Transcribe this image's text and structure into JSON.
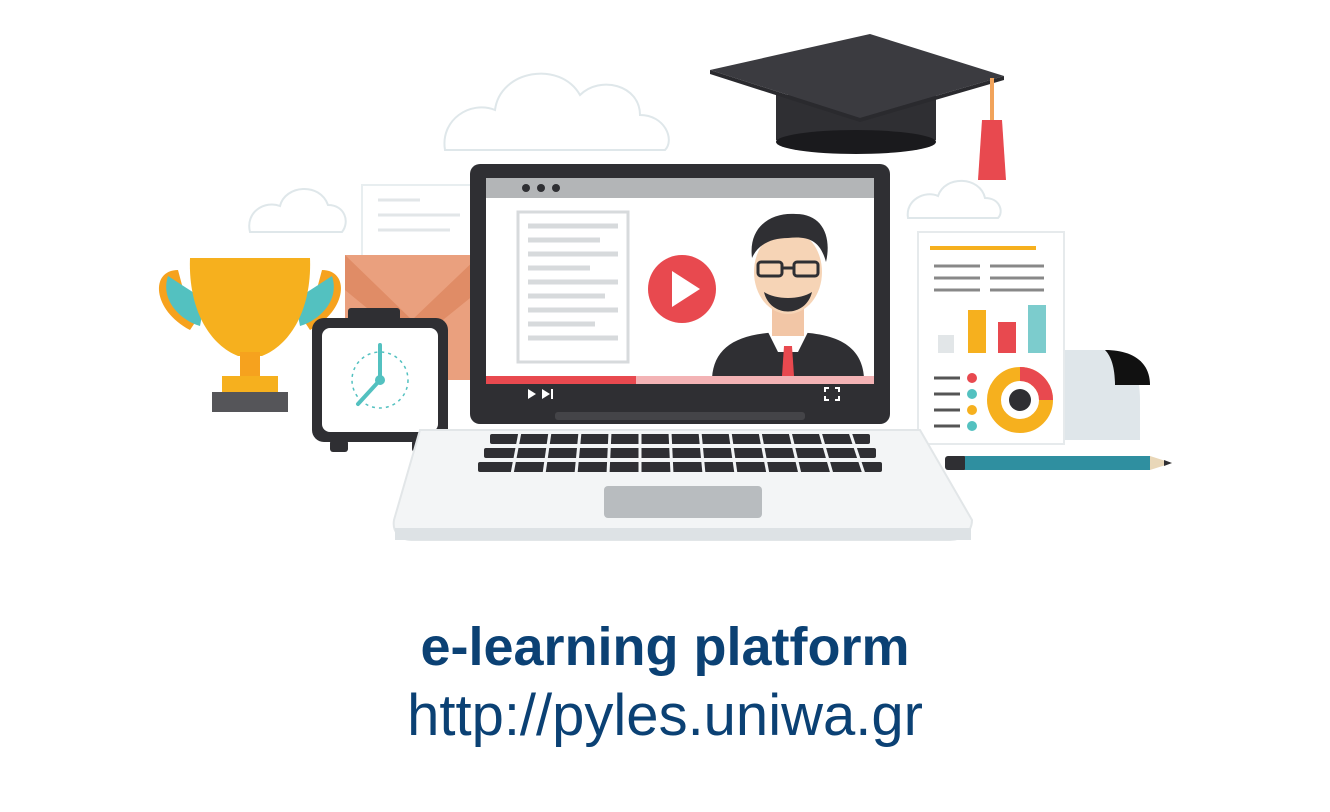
{
  "caption": {
    "title": "e-learning platform",
    "url": "http://pyles.uniwa.gr"
  },
  "illustration": {
    "icons": [
      "graduation-cap-icon",
      "laptop-icon",
      "video-play-icon",
      "teacher-avatar-icon",
      "trophy-icon",
      "alarm-clock-icon",
      "envelope-icon",
      "report-chart-icon",
      "pencil-icon",
      "cloud-icon"
    ],
    "colors": {
      "brand_text": "#0b4174",
      "play_red": "#e8494f",
      "trophy_gold": "#f6b01e",
      "teal": "#53c1c0",
      "dark": "#2f2f33",
      "accent_orange": "#e9a07d"
    }
  }
}
